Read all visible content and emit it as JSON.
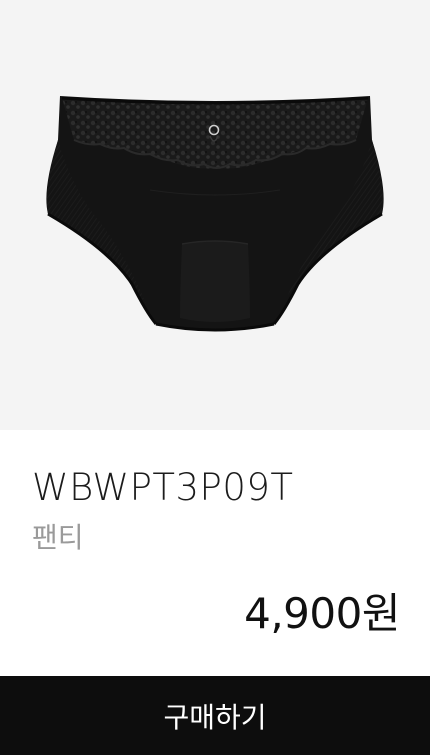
{
  "product": {
    "code": "WBWPT3P09T",
    "category": "팬티",
    "price": "4,900원",
    "image": {
      "subject": "black lace panty",
      "background_color": "#f4f4f4",
      "item_color": "#151515"
    }
  },
  "actions": {
    "buy_label": "구매하기"
  },
  "colors": {
    "button_background": "#0d0d0d",
    "button_text": "#ffffff",
    "title_text": "#1c1c1c",
    "category_text": "#9a9a9a"
  }
}
